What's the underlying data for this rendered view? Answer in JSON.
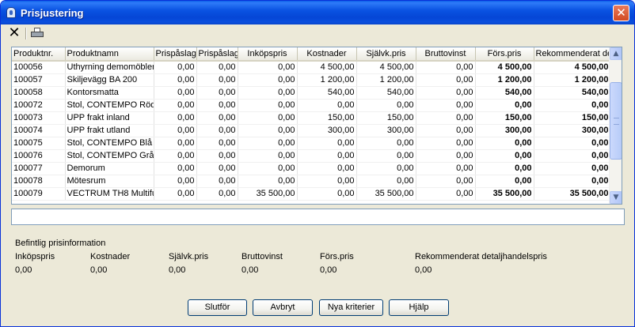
{
  "window": {
    "title": "Prisjustering",
    "close_glyph": "✕"
  },
  "toolbar": {
    "delete_glyph": "✕"
  },
  "grid": {
    "columns": [
      "Produktnr.",
      "Produktnamn",
      "Prispåslag.",
      "Prispåslag",
      "Inköpspris",
      "Kostnader",
      "Självk.pris",
      "Bruttovinst",
      "Förs.pris",
      "Rekommenderat det"
    ],
    "rows": [
      [
        "100056",
        "Uthyrning demomöbler,",
        "0,00",
        "0,00",
        "0,00",
        "4 500,00",
        "4 500,00",
        "0,00",
        "4 500,00",
        "4 500,00"
      ],
      [
        "100057",
        "Skiljevägg BA 200",
        "0,00",
        "0,00",
        "0,00",
        "1 200,00",
        "1 200,00",
        "0,00",
        "1 200,00",
        "1 200,00"
      ],
      [
        "100058",
        "Kontorsmatta",
        "0,00",
        "0,00",
        "0,00",
        "540,00",
        "540,00",
        "0,00",
        "540,00",
        "540,00"
      ],
      [
        "100072",
        "Stol, CONTEMPO Röd",
        "0,00",
        "0,00",
        "0,00",
        "0,00",
        "0,00",
        "0,00",
        "0,00",
        "0,00"
      ],
      [
        "100073",
        "UPP frakt inland",
        "0,00",
        "0,00",
        "0,00",
        "150,00",
        "150,00",
        "0,00",
        "150,00",
        "150,00"
      ],
      [
        "100074",
        "UPP frakt utland",
        "0,00",
        "0,00",
        "0,00",
        "300,00",
        "300,00",
        "0,00",
        "300,00",
        "300,00"
      ],
      [
        "100075",
        "Stol, CONTEMPO Blå -",
        "0,00",
        "0,00",
        "0,00",
        "0,00",
        "0,00",
        "0,00",
        "0,00",
        "0,00"
      ],
      [
        "100076",
        "Stol, CONTEMPO Grå -",
        "0,00",
        "0,00",
        "0,00",
        "0,00",
        "0,00",
        "0,00",
        "0,00",
        "0,00"
      ],
      [
        "100077",
        "Demorum",
        "0,00",
        "0,00",
        "0,00",
        "0,00",
        "0,00",
        "0,00",
        "0,00",
        "0,00"
      ],
      [
        "100078",
        "Mötesrum",
        "0,00",
        "0,00",
        "0,00",
        "0,00",
        "0,00",
        "0,00",
        "0,00",
        "0,00"
      ],
      [
        "100079",
        "VECTRUM TH8 Multifu",
        "0,00",
        "0,00",
        "35 500,00",
        "0,00",
        "35 500,00",
        "0,00",
        "35 500,00",
        "35 500,00"
      ]
    ],
    "scroll_up_glyph": "▲",
    "scroll_down_glyph": "▼"
  },
  "info": {
    "title": "Befintlig prisinformation",
    "labels": [
      "Inköpspris",
      "Kostnader",
      "Självk.pris",
      "Bruttovinst",
      "Förs.pris",
      "Rekommenderat detaljhandelspris"
    ],
    "values": [
      "0,00",
      "0,00",
      "0,00",
      "0,00",
      "0,00",
      "0,00"
    ]
  },
  "buttons": {
    "finish": "Slutför",
    "cancel": "Avbryt",
    "new_criteria": "Nya kriterier",
    "help": "Hjälp"
  }
}
